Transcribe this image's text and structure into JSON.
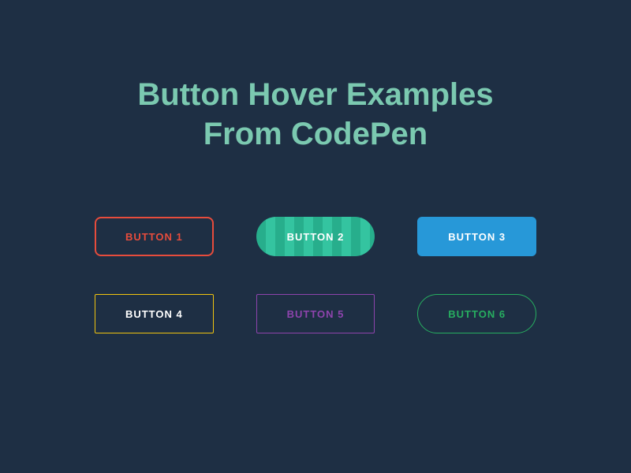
{
  "title": "Button Hover Examples\nFrom CodePen",
  "buttons": {
    "btn1": "BUTTON 1",
    "btn2": "BUTTON 2",
    "btn3": "BUTTON 3",
    "btn4": "BUTTON 4",
    "btn5": "BUTTON 5",
    "btn6": "BUTTON 6"
  }
}
